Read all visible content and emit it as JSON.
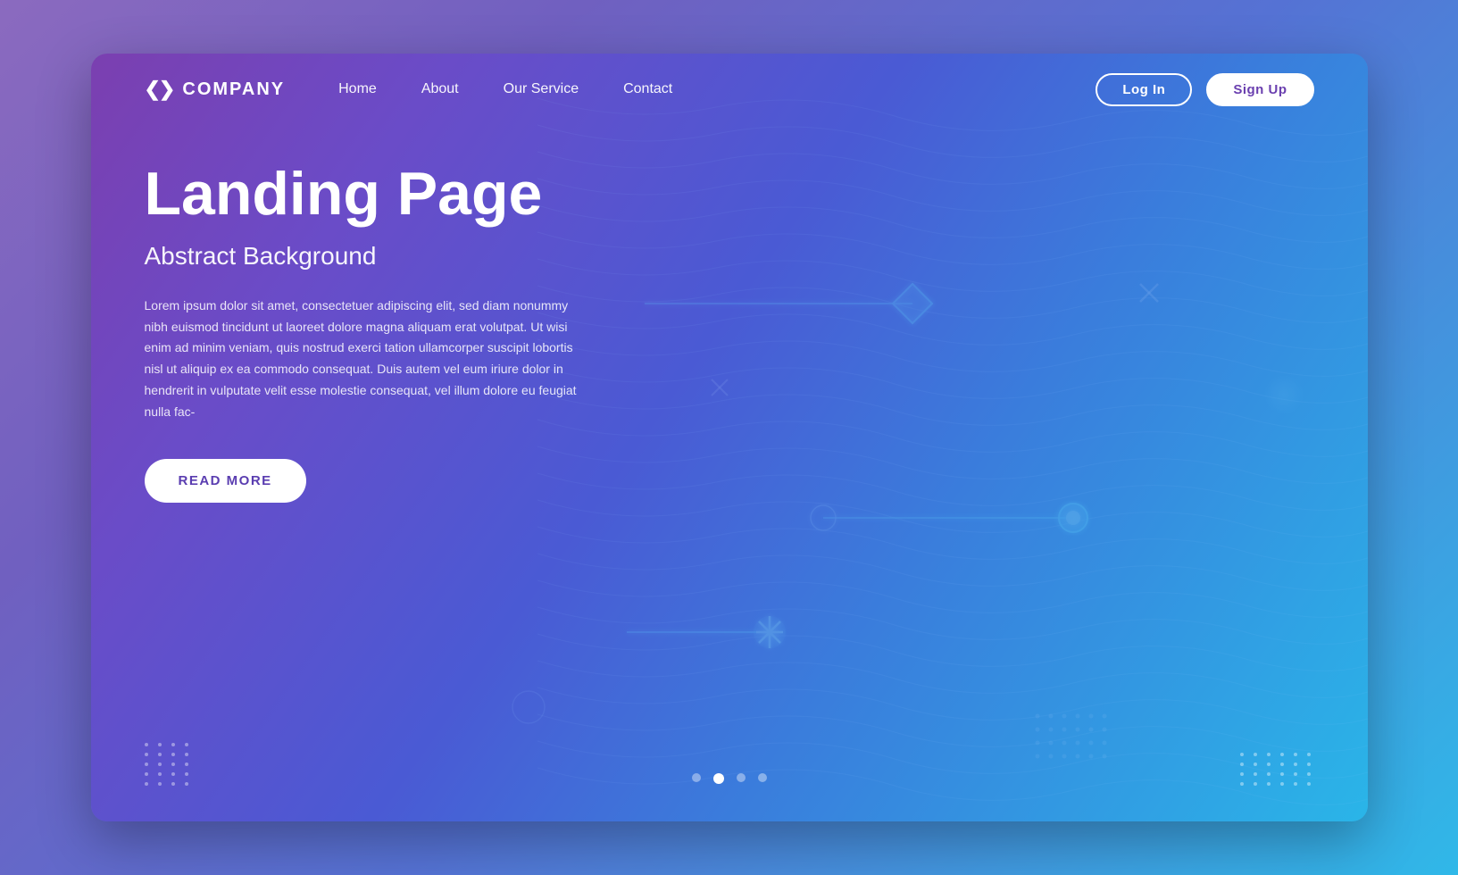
{
  "page": {
    "background_outer": "#8b6abf",
    "title": "Landing Page"
  },
  "navbar": {
    "logo_icon": "❮❯",
    "logo_text": "COMPANY",
    "links": [
      {
        "label": "Home",
        "id": "home"
      },
      {
        "label": "About",
        "id": "about"
      },
      {
        "label": "Our Service",
        "id": "our-service"
      },
      {
        "label": "Contact",
        "id": "contact"
      }
    ],
    "login_label": "Log In",
    "signup_label": "Sign Up"
  },
  "hero": {
    "title": "Landing Page",
    "subtitle": "Abstract Background",
    "body": "Lorem ipsum dolor sit amet, consectetuer adipiscing elit, sed diam nonummy nibh euismod tincidunt ut laoreet dolore magna aliquam erat volutpat. Ut wisi enim ad minim veniam, quis nostrud exerci tation ullamcorper suscipit lobortis nisl ut aliquip ex ea commodo consequat. Duis autem vel eum iriure dolor in hendrerit in vulputate velit esse molestie consequat, vel illum dolore eu feugiat nulla fac-",
    "cta_label": "READ MORE"
  },
  "slider": {
    "dots": [
      {
        "active": false
      },
      {
        "active": true
      },
      {
        "active": false
      },
      {
        "active": false
      }
    ]
  },
  "dots_left_count": 20,
  "dots_right_count": 24
}
